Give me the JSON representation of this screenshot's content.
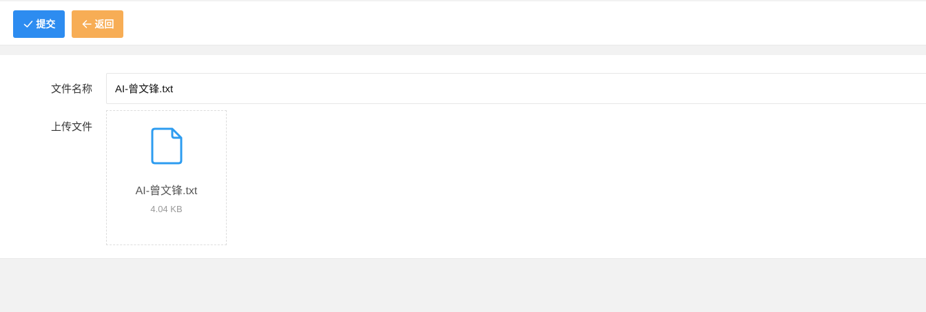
{
  "toolbar": {
    "submit_label": "提交",
    "submit_icon": "check-icon",
    "back_label": "返回",
    "back_icon": "arrow-left-icon",
    "submit_color": "#2d8cf0",
    "back_color": "#f7ad55"
  },
  "form": {
    "name_label": "文件名称",
    "name_value": "AI-曾文锋.txt",
    "upload_label": "上传文件",
    "uploaded_file": {
      "icon": "file-icon",
      "name": "AI-曾文锋.txt",
      "size": "4.04 KB",
      "icon_color": "#2d9cf0"
    }
  }
}
